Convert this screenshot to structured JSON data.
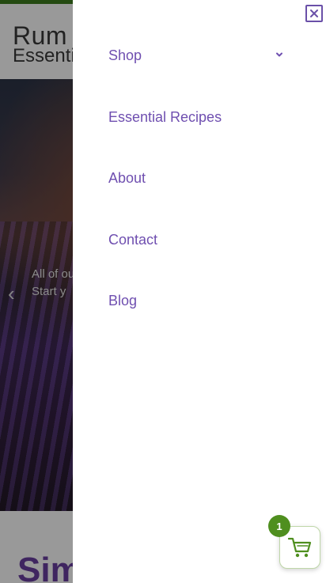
{
  "background_page": {
    "logo_line1": "Rum",
    "logo_line2": "Essenti",
    "hero_caption_line1": "All of ou",
    "hero_caption_line2": "Start y",
    "hero_prev_arrow": "‹",
    "heading_partial": "Sim"
  },
  "drawer": {
    "close_icon": "close-icon",
    "nav": [
      {
        "label": "Shop",
        "has_submenu": true
      },
      {
        "label": "Essential Recipes",
        "has_submenu": false
      },
      {
        "label": "About",
        "has_submenu": false
      },
      {
        "label": "Contact",
        "has_submenu": false
      },
      {
        "label": "Blog",
        "has_submenu": false
      }
    ]
  },
  "cart": {
    "count": "1",
    "icon": "cart-icon"
  },
  "colors": {
    "brand_purple": "#6f4fb0",
    "brand_green": "#4f8f1f",
    "top_strip_green": "#3f7d1e"
  }
}
